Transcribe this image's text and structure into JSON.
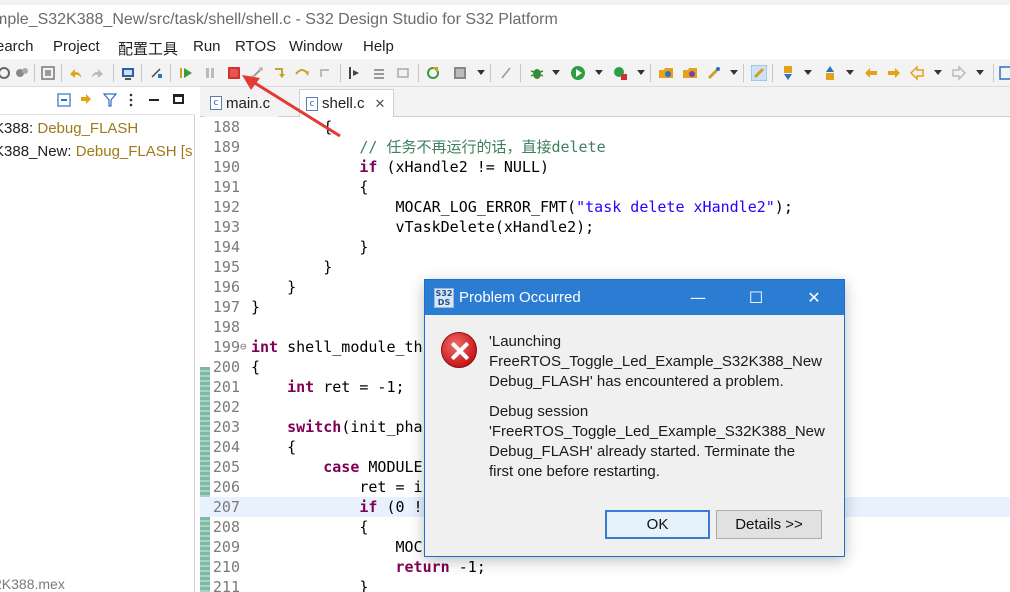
{
  "window": {
    "title": "mple_S32K388_New/src/task/shell/shell.c - S32 Design Studio for S32 Platform"
  },
  "menu": [
    "earch",
    "Project",
    "配置工具",
    "Run",
    "RTOS",
    "Window",
    "Help"
  ],
  "toolbar_icons": [
    "new-icon",
    "build-icon",
    "save-icon",
    "undo-icon",
    "redo-icon",
    "terminal-icon",
    "debug-icon",
    "resume-icon",
    "suspend-icon",
    "terminate-icon",
    "disconnect-icon",
    "step-into-icon",
    "step-over-icon",
    "step-return-icon",
    "step-filter-icon",
    "restart-icon",
    "chip-icon",
    "bug-icon",
    "run-icon",
    "run-external-icon",
    "open-type-icon",
    "open-task-icon",
    "marker-icon",
    "highlight-icon",
    "next-annotation-icon",
    "prev-annotation-icon",
    "back-icon",
    "forward-icon",
    "panel-icon"
  ],
  "project_explorer": {
    "items": [
      {
        "project": "K388:",
        "config": " Debug_FLASH"
      },
      {
        "project": "K388_New:",
        "config": " Debug_FLASH [s"
      }
    ],
    "bottom_item": "2K388.mex"
  },
  "tabs": [
    {
      "label": "main.c"
    },
    {
      "label": "shell.c",
      "close": "✕"
    }
  ],
  "code_lines": [
    {
      "num": "188",
      "text": "        {"
    },
    {
      "num": "189",
      "text": "            // 任务不再运行的话，直接delete"
    },
    {
      "num": "190",
      "text": "            if (xHandle2 != NULL)"
    },
    {
      "num": "191",
      "text": "            {"
    },
    {
      "num": "192",
      "text": "                MOCAR_LOG_ERROR_FMT(\"task delete xHandle2\");"
    },
    {
      "num": "193",
      "text": "                vTaskDelete(xHandle2);"
    },
    {
      "num": "194",
      "text": "            }"
    },
    {
      "num": "195",
      "text": "        }"
    },
    {
      "num": "196",
      "text": "    }"
    },
    {
      "num": "197",
      "text": "}"
    },
    {
      "num": "198",
      "text": ""
    },
    {
      "num": "199",
      "text": "int shell_module_th"
    },
    {
      "num": "200",
      "text": "{"
    },
    {
      "num": "201",
      "text": "    int ret = -1;"
    },
    {
      "num": "202",
      "text": ""
    },
    {
      "num": "203",
      "text": "    switch(init_pha"
    },
    {
      "num": "204",
      "text": "    {"
    },
    {
      "num": "205",
      "text": "        case MODULE"
    },
    {
      "num": "206",
      "text": "            ret = i"
    },
    {
      "num": "207",
      "text": "            if (0 !"
    },
    {
      "num": "208",
      "text": "            {"
    },
    {
      "num": "209",
      "text": "                MOC"
    },
    {
      "num": "210",
      "text": "                return -1;"
    },
    {
      "num": "211",
      "text": "            }"
    }
  ],
  "dialog": {
    "title": "Problem Occurred",
    "icon_label": "S32DS",
    "message1": "'Launching\nFreeRTOS_Toggle_Led_Example_S32K388_New\nDebug_FLASH' has encountered a problem.",
    "message2": "Debug session\n'FreeRTOS_Toggle_Led_Example_S32K388_New\nDebug_FLASH' already started. Terminate the\nfirst one before restarting.",
    "ok_label": "OK",
    "details_label": "Details >>",
    "min_glyph": "—",
    "max_glyph": "☐",
    "close_glyph": "✕"
  },
  "colors": {
    "keyword": "#7f0055",
    "string": "#2a00ff",
    "comment": "#3f7f5f",
    "dialog_title_bg": "#2b7cd3",
    "arrow": "#e53935",
    "terminate_button": "#d32f2f"
  }
}
